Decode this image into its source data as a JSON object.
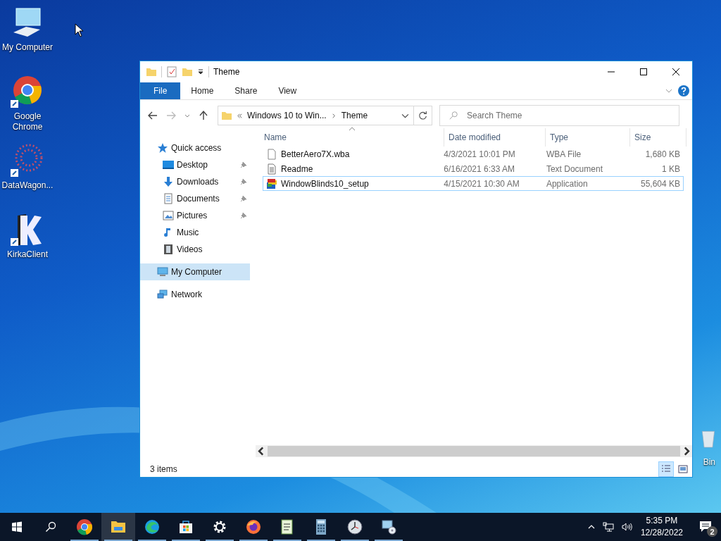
{
  "desktop_icons": [
    {
      "label": "My Computer",
      "kind": "computer"
    },
    {
      "label": "Google\nChrome",
      "kind": "chrome"
    },
    {
      "label": "DataWagon...",
      "kind": "dots"
    },
    {
      "label": "KirkaClient",
      "kind": "kirka"
    }
  ],
  "recycle_bin": {
    "label": "Bin"
  },
  "window": {
    "title": "Theme",
    "ribbon_tabs": [
      {
        "label": "File",
        "selected": true
      },
      {
        "label": "Home",
        "selected": false
      },
      {
        "label": "Share",
        "selected": false
      },
      {
        "label": "View",
        "selected": false
      }
    ],
    "breadcrumb": [
      "Windows 10 to Win...",
      "Theme"
    ],
    "search": {
      "placeholder": "Search Theme"
    },
    "sidebar": [
      {
        "label": "Quick access",
        "kind": "star",
        "selected": false,
        "children": [
          {
            "label": "Desktop",
            "kind": "desktop",
            "pinned": true,
            "selected": false
          },
          {
            "label": "Downloads",
            "kind": "download",
            "pinned": true,
            "selected": false
          },
          {
            "label": "Documents",
            "kind": "document",
            "pinned": true,
            "selected": false
          },
          {
            "label": "Pictures",
            "kind": "pictures",
            "pinned": true,
            "selected": false
          },
          {
            "label": "Music",
            "kind": "music",
            "pinned": false,
            "selected": false
          },
          {
            "label": "Videos",
            "kind": "videos",
            "pinned": false,
            "selected": false
          }
        ]
      },
      {
        "label": "My Computer",
        "kind": "computer",
        "selected": true
      },
      {
        "label": "Network",
        "kind": "network",
        "selected": false
      }
    ],
    "columns": [
      "Name",
      "Date modified",
      "Type",
      "Size"
    ],
    "files": [
      {
        "name": "BetterAero7X.wba",
        "date": "4/3/2021 10:01 PM",
        "type": "WBA File",
        "size": "1,680 KB",
        "kind": "file",
        "selected": false
      },
      {
        "name": "Readme",
        "date": "6/16/2021 6:33 AM",
        "type": "Text Document",
        "size": "1 KB",
        "kind": "text",
        "selected": false
      },
      {
        "name": "WindowBlinds10_setup",
        "date": "4/15/2021 10:30 AM",
        "type": "Application",
        "size": "55,604 KB",
        "kind": "app",
        "selected": true
      }
    ],
    "status_bar": {
      "count": "3 items"
    },
    "views": [
      {
        "kind": "details",
        "selected": true
      },
      {
        "kind": "tiles",
        "selected": false
      }
    ]
  },
  "taskbar": {
    "apps": [
      {
        "kind": "chrome",
        "selected": false
      },
      {
        "kind": "explorer",
        "selected": true
      },
      {
        "kind": "edge",
        "selected": false
      },
      {
        "kind": "store",
        "selected": false
      },
      {
        "kind": "settings",
        "selected": false
      },
      {
        "kind": "firefox",
        "selected": false
      },
      {
        "kind": "notepad",
        "selected": false
      },
      {
        "kind": "calculator",
        "selected": false
      },
      {
        "kind": "clock",
        "selected": false
      },
      {
        "kind": "monitor",
        "selected": false
      }
    ],
    "time": "5:35 PM",
    "date": "12/28/2022",
    "notifications": "2"
  }
}
